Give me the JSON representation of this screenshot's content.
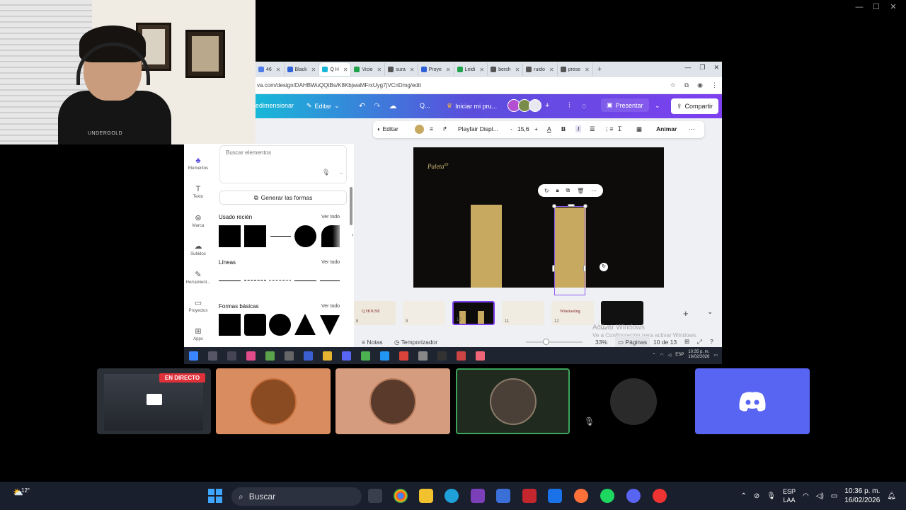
{
  "browser": {
    "tabs": [
      {
        "label": "46",
        "color": "#4f7be8"
      },
      {
        "label": "Black",
        "color": "#2f62d8"
      },
      {
        "label": "Q H",
        "color": "#18b6d8",
        "active": true
      },
      {
        "label": "Vicio",
        "color": "#1fa34a"
      },
      {
        "label": "sura",
        "color": "#555555"
      },
      {
        "label": "Proye",
        "color": "#2f62d8"
      },
      {
        "label": "Leidi",
        "color": "#1fa34a"
      },
      {
        "label": "bersh",
        "color": "#555555"
      },
      {
        "label": "ruido",
        "color": "#555555"
      },
      {
        "label": "prese",
        "color": "#555555"
      }
    ],
    "new_tab": "+",
    "url": "va.com/design/DAHBWuQQtBs/K8KbjwaMFrxUyg7jVCnDmg/edit"
  },
  "canva_bar": {
    "resize": "edimensionar",
    "edit": "Editar",
    "search_short": "Q...",
    "trial": "Iniciar mi pru...",
    "present": "Presentar",
    "share": "Compartir"
  },
  "text_toolbar": {
    "edit": "Editar",
    "font": "Playfair Displ...",
    "size": "15,6",
    "minus": "-",
    "plus": "+",
    "bold": "B",
    "italic": "I",
    "animate": "Animar",
    "color": "#c7a960"
  },
  "slide": {
    "title": "Paleta",
    "title_sup": "03",
    "bar_color": "#c7a960",
    "bg_color": "#0d0c0a"
  },
  "thumbnails": [
    {
      "num": "8",
      "label": "Q HOUSE",
      "bg": "#efe8dc"
    },
    {
      "num": "9",
      "label": "",
      "bg": "#f1ede4"
    },
    {
      "num": "10",
      "label": "",
      "bg": "#0d0c0a",
      "selected": true
    },
    {
      "num": "11",
      "label": "",
      "bg": "#f1ece2"
    },
    {
      "num": "12",
      "label": "Winetasting",
      "bg": "#f1ece2"
    },
    {
      "num": "",
      "label": "",
      "bg": "#111111"
    }
  ],
  "footer": {
    "notes": "Notas",
    "timer": "Temporizador",
    "zoom": "33%",
    "pages": "Páginas",
    "page_count": "10 de 13"
  },
  "activate_windows": {
    "line1": "Activar Windows",
    "line2": "Ve a Configuración para activar Windows."
  },
  "left_panel": {
    "rail": [
      {
        "label": "Elementos",
        "icon": "♣"
      },
      {
        "label": "Texto",
        "icon": "T"
      },
      {
        "label": "Marca",
        "icon": "⊚"
      },
      {
        "label": "Subidos",
        "icon": "☁"
      },
      {
        "label": "Herramient...",
        "icon": "✎"
      },
      {
        "label": "Proyectos",
        "icon": "▭"
      },
      {
        "label": "Apps",
        "icon": "⊞"
      }
    ],
    "search_placeholder": "Buscar elementos",
    "generate": "Generar las formas",
    "recent_title": "Usado recién",
    "lines_title": "Líneas",
    "basic_title": "Formas básicas",
    "see_all": "Ver todo"
  },
  "inner_taskbar": {
    "lang": "ESP",
    "time": "10:35 p. m.",
    "date": "16/02/2026"
  },
  "call": {
    "live": "EN DIRECTO"
  },
  "taskbar": {
    "search": "Buscar",
    "lang_line1": "ESP",
    "lang_line2": "LAA",
    "time": "10:36 p. m.",
    "date": "16/02/2026",
    "weather": "12°"
  }
}
